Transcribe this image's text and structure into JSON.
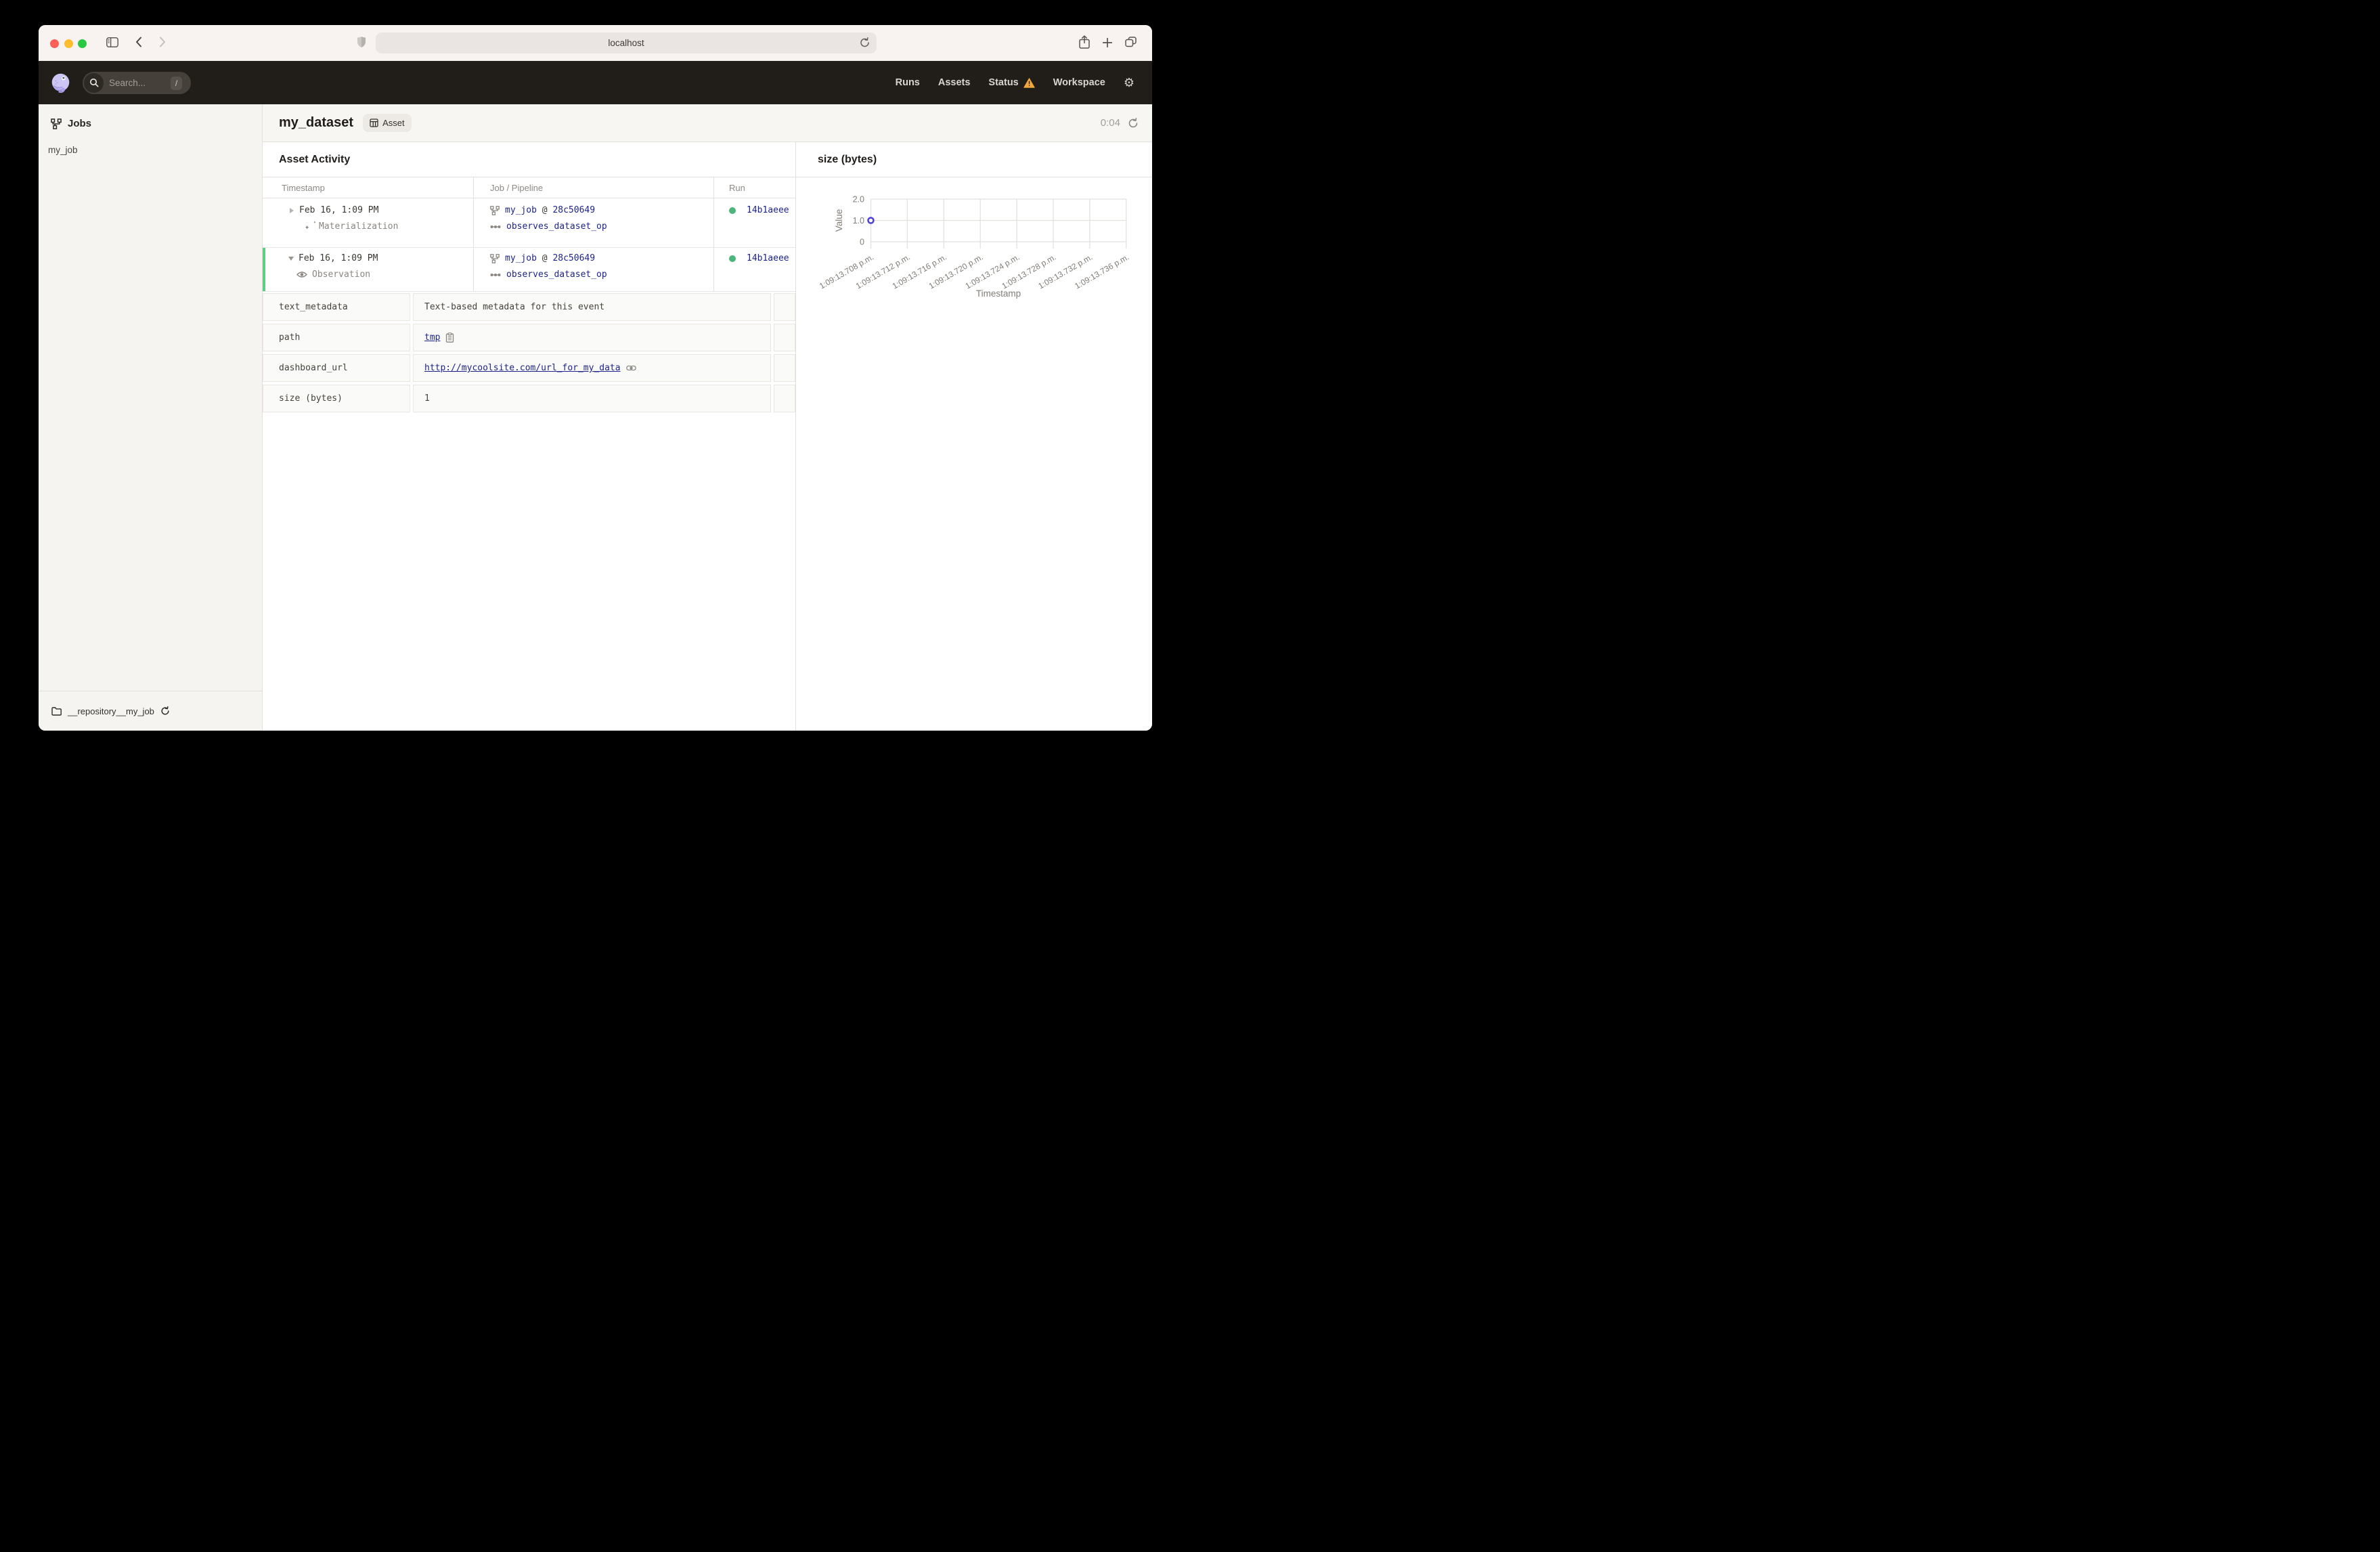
{
  "browser": {
    "url": "localhost"
  },
  "appheader": {
    "search_placeholder": "Search...",
    "search_shortcut": "/",
    "nav": [
      {
        "label": "Runs",
        "warning": false
      },
      {
        "label": "Assets",
        "warning": false
      },
      {
        "label": "Status",
        "warning": true
      },
      {
        "label": "Workspace",
        "warning": false
      }
    ]
  },
  "sidebar": {
    "title": "Jobs",
    "items": [
      {
        "label": "my_job"
      }
    ],
    "footer": {
      "repository": "__repository__my_job"
    }
  },
  "page": {
    "title": "my_dataset",
    "tag": "Asset",
    "timer": "0:04"
  },
  "activity": {
    "heading": "Asset Activity",
    "columns": {
      "timestamp": "Timestamp",
      "job": "Job / Pipeline",
      "run": "Run"
    },
    "rows": [
      {
        "timestamp": "Feb 16, 1:09 PM",
        "event_type": "Materialization",
        "job": "my_job",
        "at": "@",
        "run_hash": "28c50649",
        "op": "observes_dataset_op",
        "run_id": "14b1aeee"
      },
      {
        "timestamp": "Feb 16, 1:09 PM",
        "event_type": "Observation",
        "job": "my_job",
        "at": "@",
        "run_hash": "28c50649",
        "op": "observes_dataset_op",
        "run_id": "14b1aeee"
      }
    ],
    "metadata": {
      "rows": [
        {
          "key": "text_metadata",
          "value": "Text-based metadata for this event"
        },
        {
          "key": "path",
          "value": "tmp"
        },
        {
          "key": "dashboard_url",
          "value": "http://mycoolsite.com/url_for_my_data"
        },
        {
          "key": "size (bytes)",
          "value": "1"
        }
      ]
    }
  },
  "chart_data": {
    "type": "scatter",
    "title": "size (bytes)",
    "xlabel": "Timestamp",
    "ylabel": "Value",
    "ylim": [
      0,
      2.0
    ],
    "yticks": [
      "0",
      "1.0",
      "2.0"
    ],
    "x_ticklabels": [
      "1:09:13.708 p.m.",
      "1:09:13.712 p.m.",
      "1:09:13.716 p.m.",
      "1:09:13.720 p.m.",
      "1:09:13.724 p.m.",
      "1:09:13.728 p.m.",
      "1:09:13.732 p.m.",
      "1:09:13.736 p.m."
    ],
    "points": [
      {
        "x_index": 0,
        "x": "1:09:13.708 p.m.",
        "y": 1.0
      }
    ],
    "grid": true,
    "colors": {
      "point": "#4a3fd4",
      "grid": "#e3e1dd",
      "label": "#817c76"
    }
  },
  "colors": {
    "link": "#1e238c",
    "success_green": "#4cb57c",
    "expanded_green": "#5ece84",
    "warning_yellow": "#efa63a",
    "header_bg": "#211e1a"
  }
}
